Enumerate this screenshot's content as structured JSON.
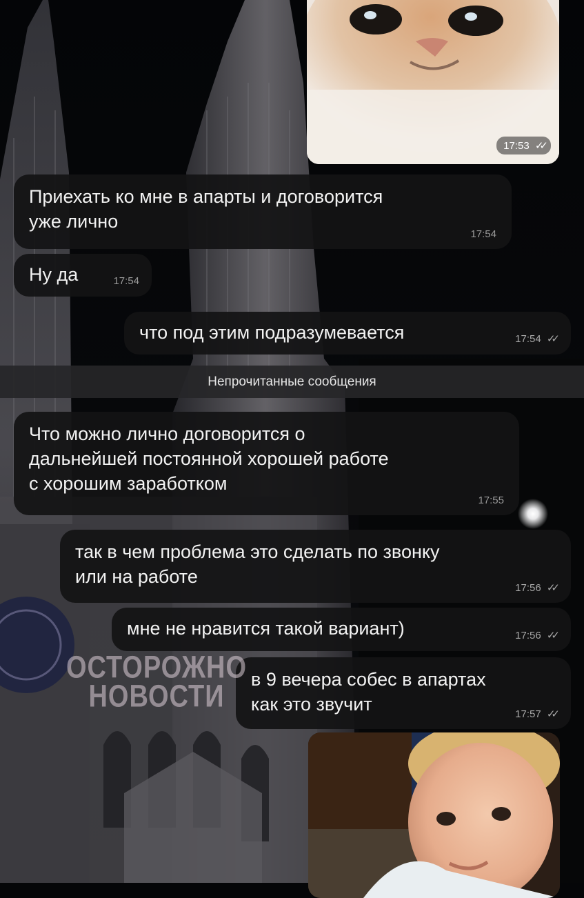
{
  "messages": [
    {
      "id": "m1",
      "direction": "incoming",
      "text_lines": [
        "Приехать ко мне в апарты и договорится",
        "уже лично"
      ],
      "time": "17:54"
    },
    {
      "id": "m2",
      "direction": "incoming",
      "text_lines": [
        "Ну да"
      ],
      "time": "17:54"
    },
    {
      "id": "m3",
      "direction": "outgoing",
      "text_lines": [
        "что под этим подразумевается"
      ],
      "time": "17:54",
      "status": "read"
    },
    {
      "id": "m4",
      "direction": "incoming",
      "text_lines": [
        "Что можно лично договорится о",
        "дальнейшей постоянной хорошей работе",
        "с хорошим заработком"
      ],
      "time": "17:55"
    },
    {
      "id": "m5",
      "direction": "outgoing",
      "text_lines": [
        "так в чем проблема это сделать по звонку",
        "или на работе"
      ],
      "time": "17:56",
      "status": "read"
    },
    {
      "id": "m6",
      "direction": "outgoing",
      "text_lines": [
        "мне не нравится такой вариант)"
      ],
      "time": "17:56",
      "status": "read"
    },
    {
      "id": "m7",
      "direction": "outgoing",
      "text_lines": [
        "в 9 вечера собес в апартах",
        "как это звучит"
      ],
      "time": "17:57",
      "status": "read"
    }
  ],
  "photos": {
    "cat": {
      "time": "17:53",
      "status": "read"
    },
    "child": {}
  },
  "unread_divider": "Непрочитанные сообщения",
  "watermark": {
    "line1": "ОСТОРОЖНО",
    "line2": "НОВОСТИ"
  },
  "read_check": "✓✓",
  "colors": {
    "bubble": "#131314",
    "text": "#f2f2f2",
    "time": "#9a9a9a",
    "divider": "#262628"
  }
}
